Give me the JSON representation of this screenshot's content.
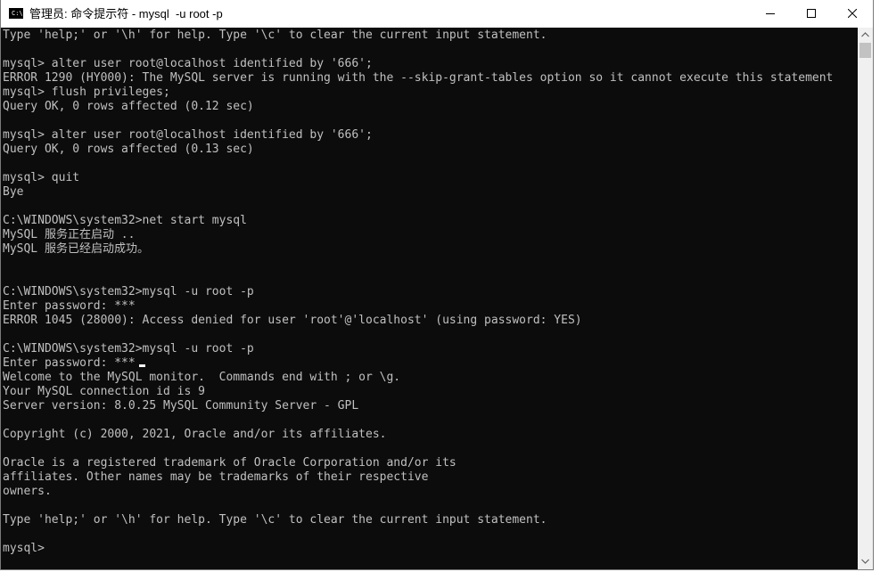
{
  "window": {
    "title": "管理员: 命令提示符 - mysql  -u root -p",
    "icon_label": "C:\\."
  },
  "console": {
    "lines": [
      "Type 'help;' or '\\h' for help. Type '\\c' to clear the current input statement.",
      "",
      "mysql> alter user root@localhost identified by '666';",
      "ERROR 1290 (HY000): The MySQL server is running with the --skip-grant-tables option so it cannot execute this statement",
      "mysql> flush privileges;",
      "Query OK, 0 rows affected (0.12 sec)",
      "",
      "mysql> alter user root@localhost identified by '666';",
      "Query OK, 0 rows affected (0.13 sec)",
      "",
      "mysql> quit",
      "Bye",
      "",
      "C:\\WINDOWS\\system32>net start mysql",
      "MySQL 服务正在启动 ..",
      "MySQL 服务已经启动成功。",
      "",
      "",
      "C:\\WINDOWS\\system32>mysql -u root -p",
      "Enter password: ***",
      "ERROR 1045 (28000): Access denied for user 'root'@'localhost' (using password: YES)",
      "",
      "C:\\WINDOWS\\system32>mysql -u root -p",
      "Enter password: ***",
      "Welcome to the MySQL monitor.  Commands end with ; or \\g.",
      "Your MySQL connection id is 9",
      "Server version: 8.0.25 MySQL Community Server - GPL",
      "",
      "Copyright (c) 2000, 2021, Oracle and/or its affiliates.",
      "",
      "Oracle is a registered trademark of Oracle Corporation and/or its",
      "affiliates. Other names may be trademarks of their respective",
      "owners.",
      "",
      "Type 'help;' or '\\h' for help. Type '\\c' to clear the current input statement.",
      "",
      "mysql>"
    ]
  },
  "icons": {
    "minimize": "minimize-icon",
    "maximize": "maximize-icon",
    "close": "close-icon",
    "scroll_up": "scroll-up-arrow-icon",
    "scroll_down": "scroll-down-arrow-icon"
  },
  "colors": {
    "console_bg": "#0c0c0c",
    "console_text": "#c0c0c0",
    "titlebar_bg": "#ffffff"
  }
}
